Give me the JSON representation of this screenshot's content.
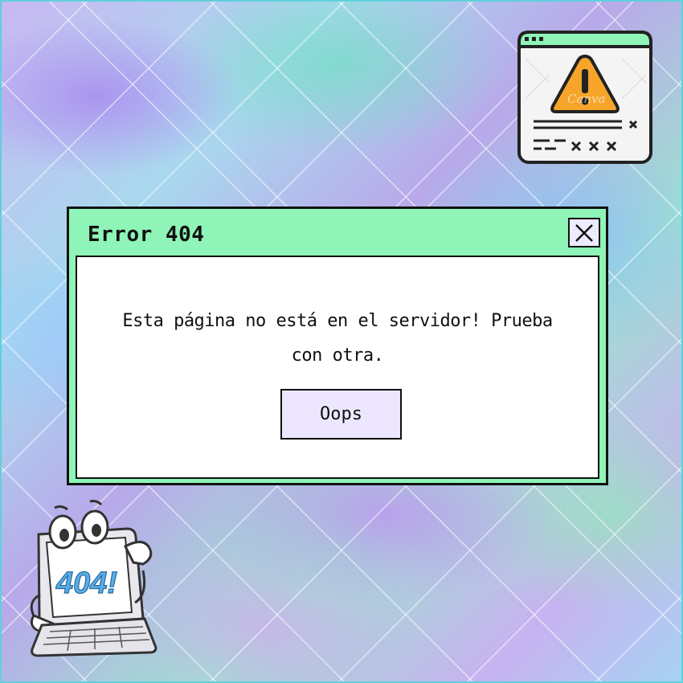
{
  "dialog": {
    "title": "Error 404",
    "message": "Esta página no está en el servidor! Prueba con otra.",
    "button_label": "Oops",
    "close_icon": "close-icon"
  },
  "warning_window_icon": {
    "watermark": "Canva"
  },
  "mascot": {
    "screen_text": "404!"
  },
  "colors": {
    "dialog_titlebar": "#8EF4B7",
    "dialog_body": "#FFFFFF",
    "button_fill": "#ECE7FF",
    "warning_fill": "#F7A52A",
    "border": "#111111"
  }
}
